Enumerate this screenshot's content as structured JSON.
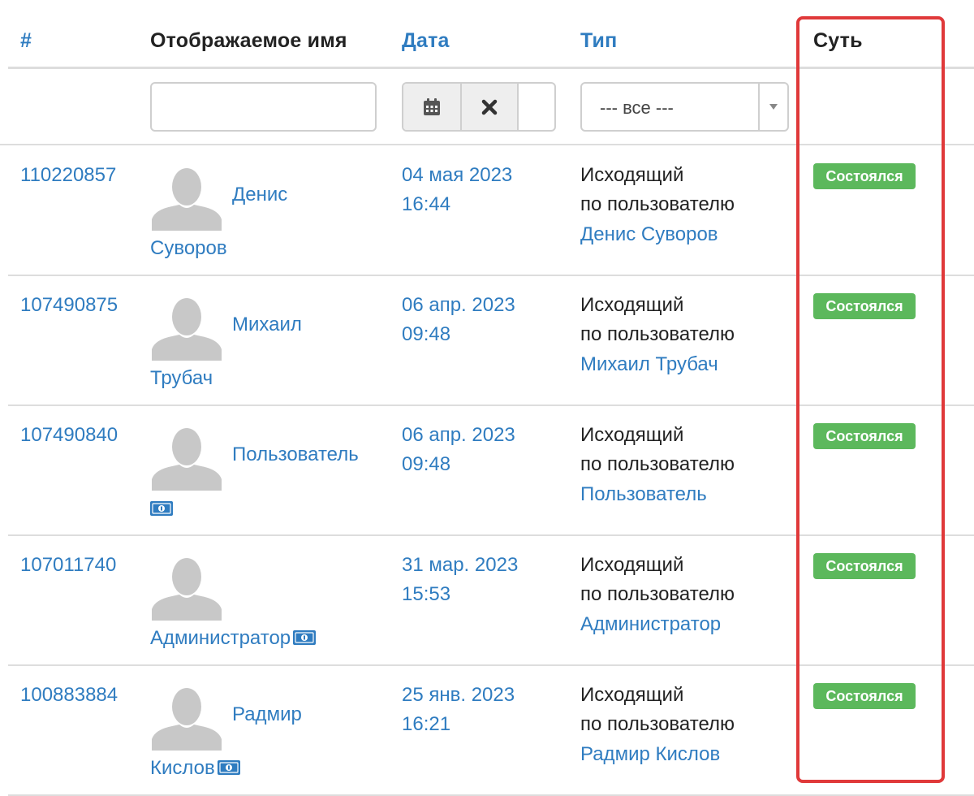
{
  "header": {
    "col_id": "#",
    "col_name": "Отображаемое имя",
    "col_date": "Дата",
    "col_type": "Тип",
    "col_essence": "Суть"
  },
  "filters": {
    "name_value": "",
    "type_select": "--- все ---",
    "icons": [
      "calendar-icon",
      "clear-x-icon",
      "chevron-down-icon"
    ]
  },
  "rows": [
    {
      "id": "110220857",
      "name_line1": "Денис",
      "name_line2": "Суворов",
      "money_icon": false,
      "date": "04 мая 2023",
      "time": "16:44",
      "type": "Исходящий",
      "type_by": "по пользователю",
      "type_user": "Денис Суворов",
      "status": "Состоялся"
    },
    {
      "id": "107490875",
      "name_line1": "Михаил",
      "name_line2": "Трубач",
      "money_icon": false,
      "date": "06 апр. 2023",
      "time": "09:48",
      "type": "Исходящий",
      "type_by": "по пользователю",
      "type_user": "Михаил Трубач",
      "status": "Состоялся"
    },
    {
      "id": "107490840",
      "name_line1": "Пользователь",
      "name_line2": "",
      "money_icon": true,
      "date": "06 апр. 2023",
      "time": "09:48",
      "type": "Исходящий",
      "type_by": "по пользователю",
      "type_user": "Пользователь",
      "status": "Состоялся"
    },
    {
      "id": "107011740",
      "name_line1": "",
      "name_line2": "Администратор",
      "money_icon": true,
      "date": "31 мар. 2023",
      "time": "15:53",
      "type": "Исходящий",
      "type_by": "по пользователю",
      "type_user": "Администратор",
      "status": "Состоялся"
    },
    {
      "id": "100883884",
      "name_line1": "Радмир",
      "name_line2": "Кислов",
      "money_icon": true,
      "date": "25 янв. 2023",
      "time": "16:21",
      "type": "Исходящий",
      "type_by": "по пользователю",
      "type_user": "Радмир Кислов",
      "status": "Состоялся"
    }
  ],
  "colors": {
    "link": "#2f7cc0",
    "badge": "#5cb85c",
    "highlight": "#e0393a"
  }
}
